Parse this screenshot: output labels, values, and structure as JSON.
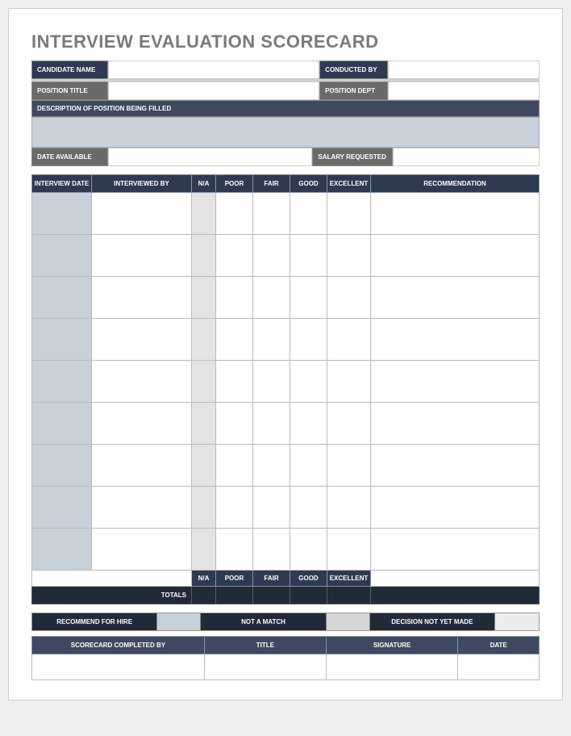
{
  "title": "INTERVIEW EVALUATION SCORECARD",
  "header": {
    "candidate_name_label": "CANDIDATE NAME",
    "conducted_by_label": "CONDUCTED BY",
    "position_title_label": "POSITION TITLE",
    "position_dept_label": "POSITION DEPT",
    "description_label": "DESCRIPTION OF POSITION BEING FILLED",
    "date_available_label": "DATE AVAILABLE",
    "salary_requested_label": "SALARY REQUESTED"
  },
  "grid": {
    "cols": {
      "interview_date": "INTERVIEW DATE",
      "interviewed_by": "INTERVIEWED BY",
      "na": "N/A",
      "poor": "POOR",
      "fair": "FAIR",
      "good": "GOOD",
      "excellent": "EXCELLENT",
      "recommendation": "RECOMMENDATION"
    },
    "totals_label": "TOTALS"
  },
  "decision": {
    "recommend": "RECOMMEND FOR HIRE",
    "not_match": "NOT A MATCH",
    "not_yet": "DECISION NOT YET MADE"
  },
  "sign": {
    "completed_by": "SCORECARD COMPLETED BY",
    "title": "TITLE",
    "signature": "SIGNATURE",
    "date": "DATE"
  }
}
